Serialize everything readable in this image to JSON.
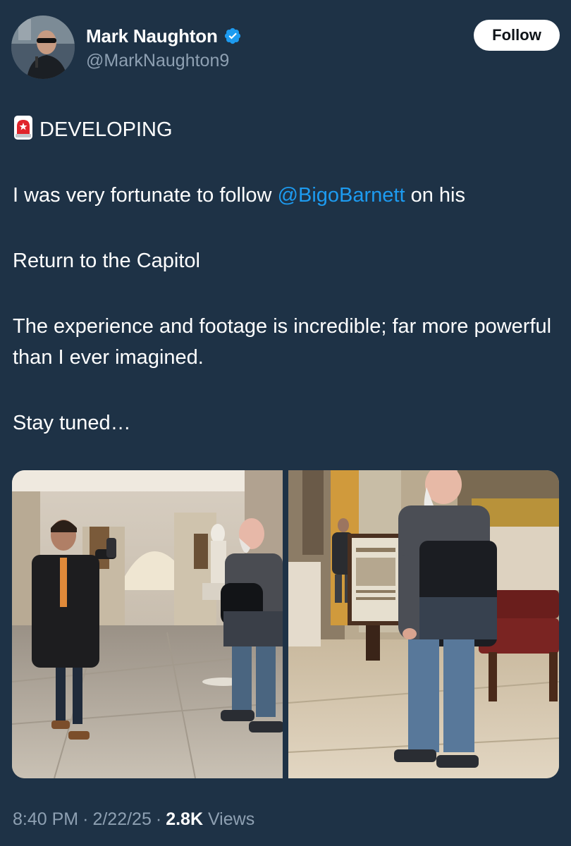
{
  "author": {
    "display_name": "Mark Naughton",
    "handle": "@MarkNaughton9",
    "verified": true,
    "avatar_icon": "profile-photo"
  },
  "follow_label": "Follow",
  "tweet": {
    "line1": "DEVELOPING",
    "line2_before": "I was very fortunate to follow ",
    "line2_mention": "@BigoBarnett",
    "line2_after": " on his",
    "line3": "Return to the Capitol",
    "line4": "The experience and footage is incredible; far more powerful than I ever imagined.",
    "line5": "Stay tuned…",
    "emoji": "siren-icon"
  },
  "media": {
    "count": 2
  },
  "meta": {
    "time": "8:40 PM",
    "date": "2/22/25",
    "views_count": "2.8K",
    "views_label": "Views"
  },
  "colors": {
    "background": "#1e3246",
    "mention": "#1d9bf0",
    "verified": "#1d9bf0",
    "secondary_text": "#8ea0b2"
  }
}
